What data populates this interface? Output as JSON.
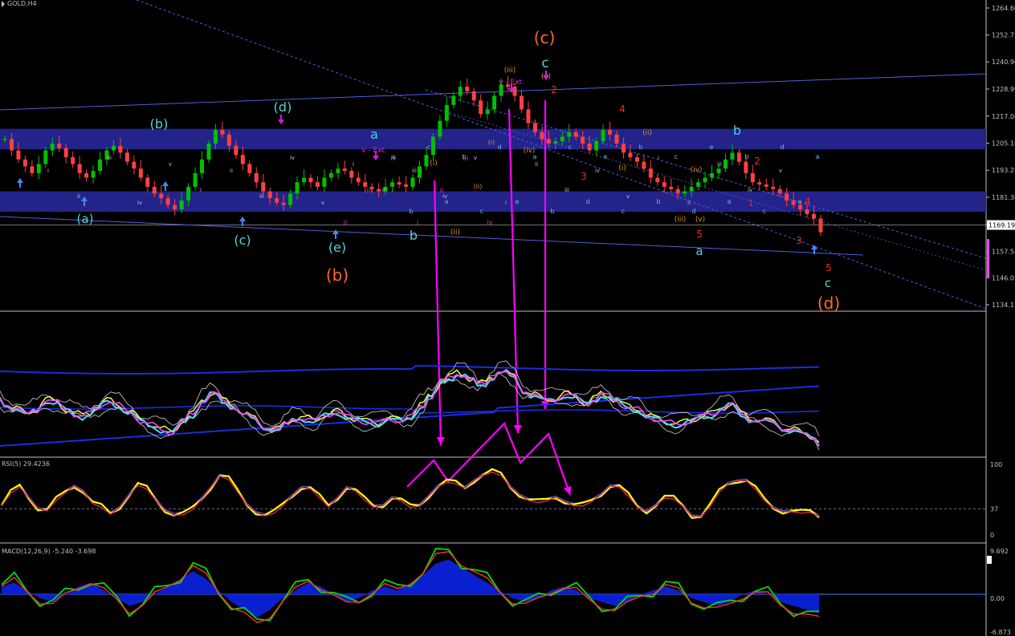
{
  "window": {
    "title": "GOLD,H4",
    "colors": {
      "background": "#000000",
      "axis": "#c0c0c0",
      "text": "#c0c0c0",
      "grid": "#5a5a5a",
      "bull": "#00c000",
      "bear": "#ff4040",
      "trend": "#4f5fe0",
      "zone": "#23238a"
    }
  },
  "price_panel": {
    "axis_labels": [
      "1264.60",
      "1252.75",
      "1240.90",
      "1228.99",
      "1217.06",
      "1205.18",
      "1193.28",
      "1181.38",
      "1169.19",
      "1157.58",
      "1146.01",
      "1134.11"
    ],
    "current_price": "1169.19"
  },
  "wave_labels": {
    "cyan": [
      "(a)",
      "(b)",
      "(c)",
      "(d)",
      "(e)",
      "a",
      "b",
      "c",
      "a",
      "b",
      "c"
    ],
    "orange": [
      "(b)",
      "(c)",
      "(d)"
    ],
    "red": [
      "4",
      "2",
      "2",
      "1",
      "3",
      "3",
      "4",
      "5",
      "5"
    ],
    "magenta": [
      "v - Ext.",
      "v - Ext."
    ],
    "orange_small": [
      "(iii)",
      "(v)",
      "(iv)",
      "(i)",
      "(ii)",
      "(i)",
      "(ii)",
      "(iii)",
      "(iv)",
      "(v)",
      "(i)",
      "(ii)"
    ],
    "small_white": [
      "i",
      "ii",
      "iii",
      "iv",
      "v",
      "i",
      "ii",
      "iii",
      "iv",
      "v",
      "i",
      "ii",
      "iii",
      "iv",
      "v",
      "i",
      "ii",
      "iii",
      "iv",
      "v",
      "i",
      "ii",
      "iii",
      "iv",
      "v"
    ],
    "small_cyan": [
      "a",
      "b",
      "c",
      "a",
      "b",
      "c",
      "d",
      "e",
      "a",
      "b",
      "c",
      "d",
      "e",
      "c",
      "b",
      "b",
      "c",
      "d",
      "e",
      "a",
      "b",
      "c",
      "d",
      "e",
      "a"
    ],
    "small_magenta": [
      "ii",
      "iii",
      "iv",
      "i",
      "ii",
      "iii",
      "iv"
    ]
  },
  "rsi_panel": {
    "title": "RSI(5) 29.4236",
    "levels": [
      "100",
      "37",
      "0"
    ]
  },
  "macd_panel": {
    "title": "MACD(12,26,9) -5.240 -3.698",
    "levels": [
      "9.692",
      "0.00",
      "-6.873"
    ]
  },
  "chart_data": {
    "type": "line",
    "title": "GOLD,H4",
    "ylim": [
      1134.11,
      1264.6
    ],
    "series": [
      {
        "values": [
          1207,
          1202,
          1198,
          1195,
          1192,
          1196,
          1202,
          1205,
          1203,
          1199,
          1196,
          1192,
          1190,
          1193,
          1198,
          1202,
          1204,
          1201,
          1197,
          1194,
          1190,
          1186,
          1183,
          1181,
          1178,
          1176,
          1180,
          1186,
          1192,
          1198,
          1205,
          1211,
          1209,
          1204,
          1200,
          1196,
          1192,
          1188,
          1184,
          1181,
          1179,
          1178,
          1183,
          1188,
          1190,
          1188,
          1186,
          1190,
          1192,
          1194,
          1193,
          1190,
          1188,
          1186,
          1185,
          1184,
          1186,
          1188,
          1187,
          1186,
          1190,
          1195,
          1200,
          1208,
          1215,
          1222,
          1226,
          1230,
          1228,
          1224,
          1218,
          1220,
          1226,
          1231,
          1230,
          1226,
          1220,
          1214,
          1210,
          1207,
          1205,
          1206,
          1208,
          1210,
          1208,
          1205,
          1202,
          1206,
          1211,
          1209,
          1205,
          1201,
          1199,
          1197,
          1194,
          1190,
          1188,
          1186,
          1185,
          1183,
          1184,
          1186,
          1188,
          1190,
          1192,
          1194,
          1198,
          1201,
          1197,
          1192,
          1188,
          1187,
          1186,
          1185,
          1183,
          1180,
          1178,
          1176,
          1174,
          1172,
          1166
        ]
      }
    ],
    "rsi": {
      "values": [
        42,
        58,
        68,
        55,
        40,
        35,
        48,
        60,
        72,
        64,
        45,
        38,
        30,
        42,
        58,
        70,
        64,
        50,
        38,
        30,
        28,
        35,
        52,
        70,
        85,
        78,
        60,
        45,
        35,
        28,
        30,
        42,
        58,
        70,
        66,
        52,
        40,
        55,
        70,
        62,
        48,
        40,
        45,
        55,
        48,
        38,
        42,
        58,
        70,
        74,
        72,
        68,
        80,
        86,
        88,
        84,
        70,
        60,
        50,
        45,
        48,
        56,
        50,
        42,
        40,
        48,
        60,
        72,
        68,
        54,
        40,
        36,
        44,
        52,
        50,
        42,
        30,
        28,
        40,
        60,
        74,
        80,
        78,
        64,
        48,
        40,
        36,
        34,
        30,
        32,
        29
      ]
    },
    "macd": {
      "values": [
        2,
        3,
        1,
        -1,
        -2,
        0,
        2,
        3,
        1,
        -1,
        -3,
        -2,
        0,
        2,
        4,
        6,
        4,
        1,
        -2,
        -4,
        -6,
        -4,
        -1,
        1,
        3,
        2,
        0,
        -2,
        -1,
        1,
        2,
        1,
        3,
        5,
        8,
        9,
        7,
        5,
        3,
        1,
        -1,
        -2,
        -1,
        1,
        2,
        1,
        -1,
        -2,
        -3,
        -2,
        0,
        1,
        2,
        1,
        -1,
        -2,
        -3,
        -2,
        0,
        1,
        0,
        -2,
        -3,
        -4,
        -5
      ]
    }
  }
}
